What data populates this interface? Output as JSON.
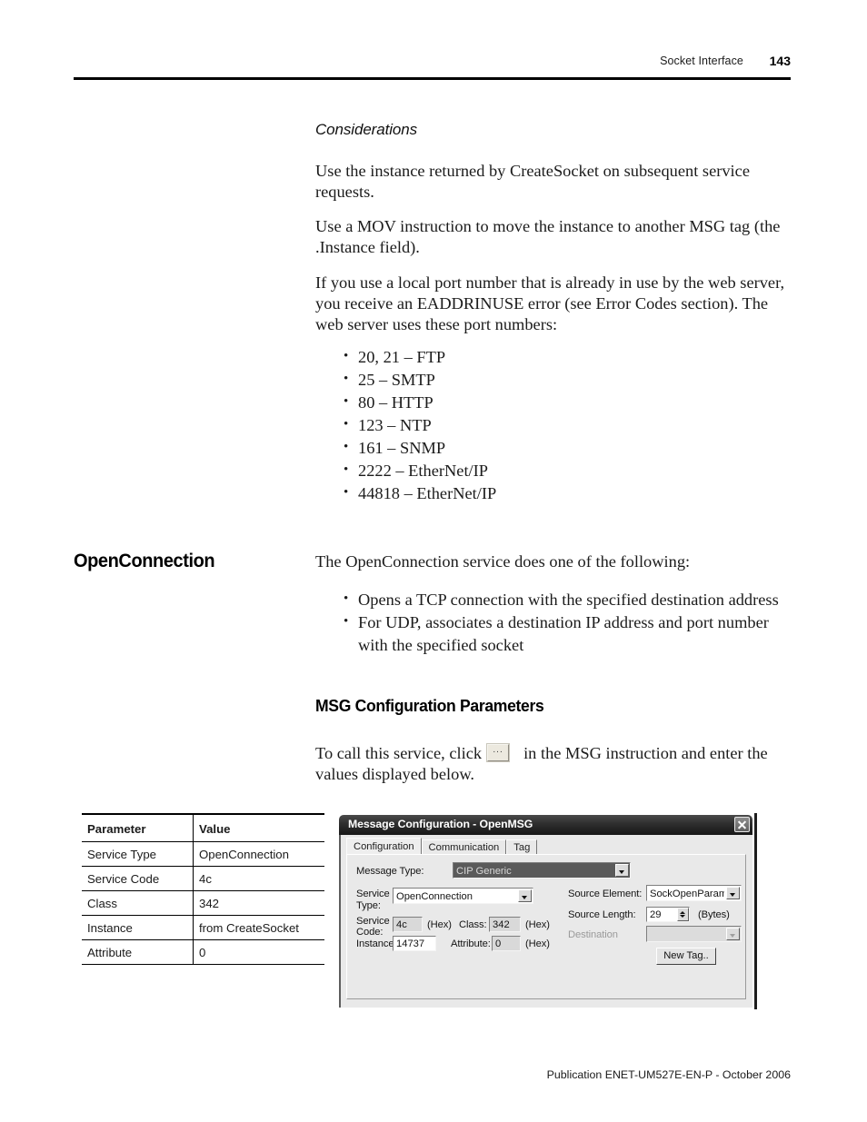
{
  "header": {
    "section_title": "Socket Interface",
    "page_number": "143"
  },
  "considerations": {
    "heading": "Considerations",
    "para_instance": "Use the instance returned by CreateSocket on subsequent service requests.",
    "para_mov": "Use a MOV instruction to move the instance to another MSG tag (the .Instance field).",
    "para_ports": "If you use a local port number that is already in use by the web server, you receive an EADDRINUSE error (see Error Codes section). The web server uses these port numbers:",
    "ports": [
      "20, 21 – FTP",
      "25 – SMTP",
      "80 – HTTP",
      "123 – NTP",
      "161 – SNMP",
      "2222 – EtherNet/IP",
      "44818 – EtherNet/IP"
    ]
  },
  "openconnection": {
    "title": "OpenConnection",
    "intro": "The OpenConnection service does one of the following:",
    "bullets": [
      "Opens a TCP connection with the specified destination address",
      "For UDP, associates a destination IP address and port number with the specified socket"
    ]
  },
  "msg_config": {
    "heading": "MSG Configuration Parameters",
    "instruction_before": "To call this service, click",
    "ellipsis_button_label": "...",
    "instruction_after": "in the MSG instruction and enter the values displayed below."
  },
  "param_table": {
    "columns": [
      "Parameter",
      "Value"
    ],
    "rows": [
      {
        "parameter": "Service Type",
        "value": "OpenConnection"
      },
      {
        "parameter": "Service Code",
        "value": "4c"
      },
      {
        "parameter": "Class",
        "value": "342"
      },
      {
        "parameter": "Instance",
        "value": "from CreateSocket"
      },
      {
        "parameter": "Attribute",
        "value": "0"
      }
    ]
  },
  "dialog": {
    "title": "Message Configuration - OpenMSG",
    "close_label": "",
    "tabs": [
      {
        "label": "Configuration",
        "active": true
      },
      {
        "label": "Communication",
        "active": false
      },
      {
        "label": "Tag",
        "active": false
      }
    ],
    "fields": {
      "message_type_label": "Message Type:",
      "message_type_value": "CIP Generic",
      "service_type_label_line1": "Service",
      "service_type_label_line2": "Type:",
      "service_type_value": "OpenConnection",
      "service_code_label_line1": "Service",
      "service_code_label_line2": "Code:",
      "service_code_value": "4c",
      "service_code_hex": "(Hex)",
      "class_label": "Class:",
      "class_value": "342",
      "class_hex": "(Hex)",
      "instance_label": "Instance:",
      "instance_value": "14737",
      "attribute_label": "Attribute:",
      "attribute_value": "0",
      "attribute_hex": "(Hex)",
      "source_element_label": "Source Element:",
      "source_element_value": "SockOpenParams",
      "source_length_label": "Source Length:",
      "source_length_value": "29",
      "source_length_units": "(Bytes)",
      "destination_label": "Destination",
      "destination_value": "",
      "new_tag_button": "New Tag.."
    }
  },
  "footer": {
    "publication": "Publication ENET-UM527E-EN-P - October 2006"
  }
}
